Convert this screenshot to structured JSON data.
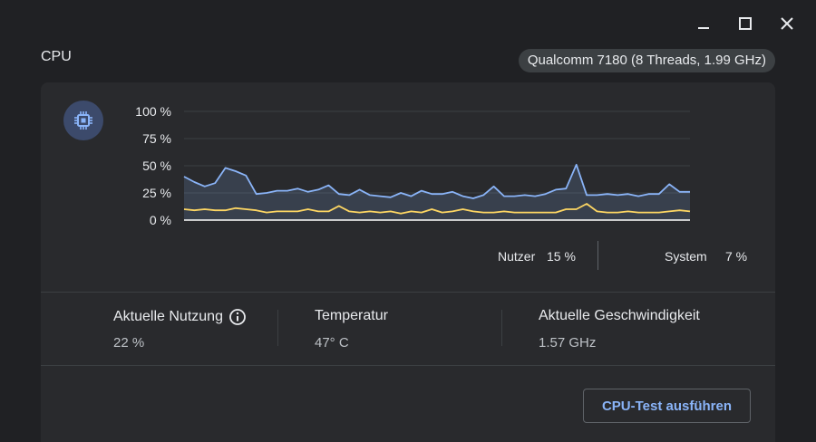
{
  "window": {
    "minimize_icon": "minimize-icon",
    "maximize_icon": "maximize-icon",
    "close_icon": "close-icon"
  },
  "header": {
    "title": "CPU",
    "cpu_model": "Qualcomm 7180 (8 Threads, 1.99 GHz)"
  },
  "colors": {
    "user_series": "#8ab4f8",
    "system_series": "#fdd663",
    "baseline": "#ffffff",
    "icon_bg": "#3c4a6b"
  },
  "chart_data": {
    "type": "line",
    "y_ticks": [
      "100 %",
      "75 %",
      "50 %",
      "25 %",
      "0 %"
    ],
    "ylim": [
      0,
      100
    ],
    "x": [
      0,
      1,
      2,
      3,
      4,
      5,
      6,
      7,
      8,
      9,
      10,
      11,
      12,
      13,
      14,
      15,
      16,
      17,
      18,
      19,
      20,
      21,
      22,
      23,
      24,
      25,
      26,
      27,
      28,
      29,
      30,
      31,
      32,
      33,
      34,
      35,
      36,
      37,
      38,
      39,
      40,
      41,
      42,
      43,
      44,
      45,
      46,
      47,
      48,
      49
    ],
    "series": [
      {
        "key": "user",
        "values": [
          40,
          35,
          31,
          34,
          48,
          45,
          41,
          24,
          25,
          27,
          27,
          29,
          26,
          28,
          32,
          24,
          23,
          28,
          23,
          22,
          21,
          25,
          22,
          27,
          24,
          24,
          26,
          22,
          20,
          23,
          31,
          22,
          22,
          23,
          22,
          24,
          28,
          29,
          51,
          23,
          23,
          24,
          23,
          24,
          22,
          24,
          24,
          33,
          26,
          26
        ]
      },
      {
        "key": "system",
        "values": [
          10,
          9,
          10,
          9,
          9,
          11,
          10,
          9,
          7,
          8,
          8,
          8,
          10,
          8,
          8,
          13,
          8,
          7,
          8,
          7,
          8,
          6,
          8,
          7,
          10,
          7,
          8,
          10,
          8,
          7,
          7,
          8,
          7,
          7,
          7,
          7,
          7,
          10,
          10,
          15,
          8,
          7,
          7,
          8,
          7,
          7,
          7,
          8,
          9,
          8
        ]
      }
    ]
  },
  "legend": {
    "user_label": "Nutzer",
    "user_value": "15 %",
    "system_label": "System",
    "system_value": "7 %"
  },
  "stats": {
    "usage_label": "Aktuelle Nutzung",
    "usage_value": "22 %",
    "temp_label": "Temperatur",
    "temp_value": "47° C",
    "speed_label": "Aktuelle Geschwindigkeit",
    "speed_value": "1.57 GHz"
  },
  "actions": {
    "run_test_label": "CPU-Test ausführen"
  }
}
